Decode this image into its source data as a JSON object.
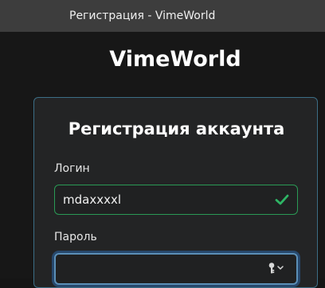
{
  "window": {
    "title": "Регистрация - VimeWorld"
  },
  "brand": {
    "name": "VimeWorld"
  },
  "form": {
    "title": "Регистрация аккаунта",
    "login": {
      "label": "Логин",
      "value": "mdaxxxxl",
      "status": "valid"
    },
    "password": {
      "label": "Пароль",
      "value": ""
    }
  },
  "colors": {
    "titlebar": "#3d3d3d",
    "background": "#171717",
    "card": "#232425",
    "card_border": "#3c6e86",
    "valid": "#2a9a55",
    "focus": "#5b8fb7"
  },
  "icons": {
    "login_status": "check-icon",
    "password_manager": "key-icon"
  }
}
